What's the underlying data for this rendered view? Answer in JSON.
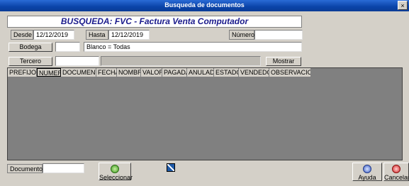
{
  "window": {
    "title": "Busqueda de documentos",
    "close_label": "×"
  },
  "heading": "BUSQUEDA: FVC - Factura Venta Computador",
  "filters": {
    "desde_label": "Desde",
    "desde_value": "12/12/2019",
    "hasta_label": "Hasta",
    "hasta_value": "12/12/2019",
    "numero_label": "Número",
    "numero_value": "",
    "bodega_label": "Bodega",
    "bodega_value": "",
    "bodega_hint": "Blanco = Todas",
    "tercero_label": "Tercero",
    "tercero_value": "",
    "tercero_name": "",
    "mostrar_label": "Mostrar"
  },
  "grid": {
    "columns": [
      "PREFIJO",
      "NUMERO",
      "DOCUMENTO",
      "FECHA",
      "NOMBRE",
      "VALOR",
      "PAGADA",
      "ANULADO",
      "ESTADO",
      "VENDEDOR",
      "OBSERVACION"
    ]
  },
  "footer": {
    "documento_label": "Documento",
    "documento_value": "",
    "seleccionar_label": "Seleccionar",
    "ayuda_label": "Ayuda",
    "cancelar_label": "Cancelar"
  }
}
